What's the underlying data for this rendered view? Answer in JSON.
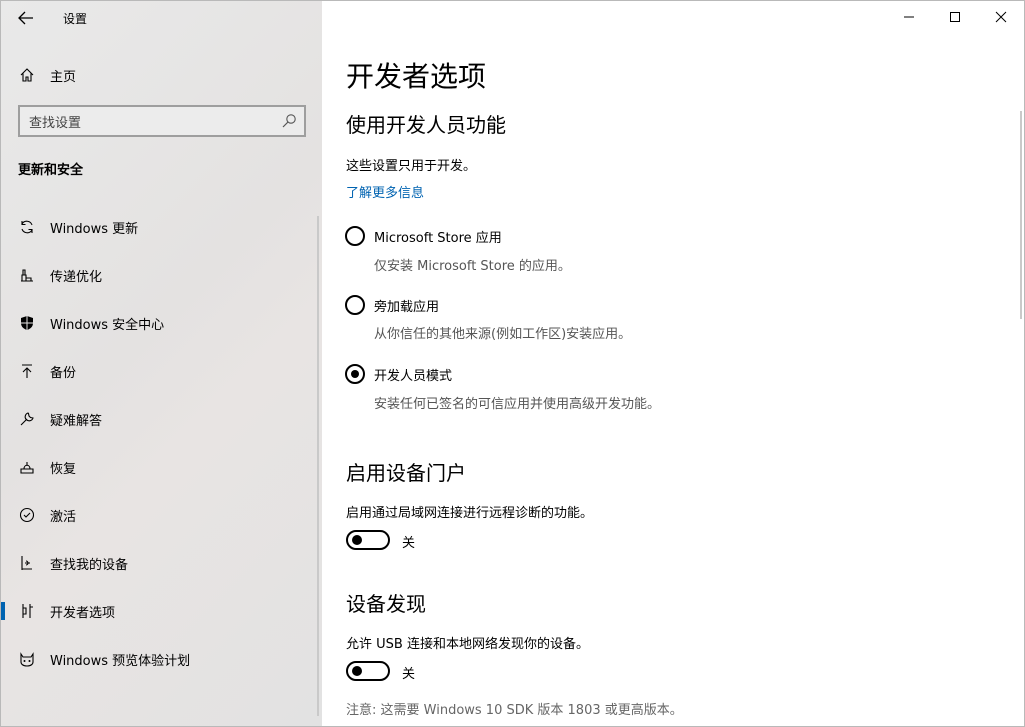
{
  "window": {
    "title": "设置"
  },
  "sidebar": {
    "home_label": "主页",
    "search_placeholder": "查找设置",
    "section_title": "更新和安全",
    "items": [
      {
        "label": "Windows 更新",
        "icon": "sync-icon"
      },
      {
        "label": "传递优化",
        "icon": "delivery-optimization-icon"
      },
      {
        "label": "Windows 安全中心",
        "icon": "shield-icon"
      },
      {
        "label": "备份",
        "icon": "backup-arrow-icon"
      },
      {
        "label": "疑难解答",
        "icon": "wrench-icon"
      },
      {
        "label": "恢复",
        "icon": "recovery-icon"
      },
      {
        "label": "激活",
        "icon": "check-circle-icon"
      },
      {
        "label": "查找我的设备",
        "icon": "person-locate-icon"
      },
      {
        "label": "开发者选项",
        "icon": "developer-tools-icon",
        "selected": true
      },
      {
        "label": "Windows 预览体验计划",
        "icon": "insider-cat-icon"
      }
    ]
  },
  "main": {
    "page_title": "开发者选项",
    "dev_features": {
      "heading": "使用开发人员功能",
      "description": "这些设置只用于开发。",
      "learn_more": "了解更多信息",
      "options": [
        {
          "label": "Microsoft Store 应用",
          "desc": "仅安装 Microsoft Store 的应用。",
          "checked": false
        },
        {
          "label": "旁加载应用",
          "desc": "从你信任的其他来源(例如工作区)安装应用。",
          "checked": false
        },
        {
          "label": "开发人员模式",
          "desc": "安装任何已签名的可信应用并使用高级开发功能。",
          "checked": true
        }
      ]
    },
    "device_portal": {
      "heading": "启用设备门户",
      "description": "启用通过局域网连接进行远程诊断的功能。",
      "toggle_state": "关"
    },
    "device_discovery": {
      "heading": "设备发现",
      "description": "允许 USB 连接和本地网络发现你的设备。",
      "toggle_state": "关",
      "note": "注意: 这需要 Windows 10 SDK 版本 1803 或更高版本。"
    }
  }
}
